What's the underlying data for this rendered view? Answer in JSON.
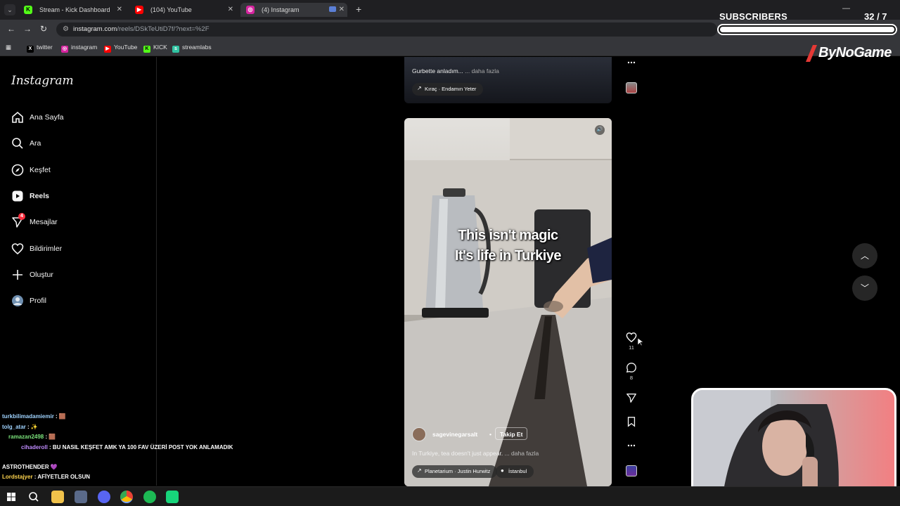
{
  "browser": {
    "tabs": [
      {
        "title": "Stream - Kick Dashboard",
        "favicon_color": "#53fc18",
        "favicon_glyph": "K"
      },
      {
        "title": "(104) YouTube",
        "favicon_color": "#ff0000",
        "favicon_glyph": "▶"
      },
      {
        "title": "(4) Instagram",
        "favicon_color": "#d6249f",
        "favicon_glyph": "◎"
      }
    ],
    "url_host": "instagram.com",
    "url_path": "/reels/DSkTeUtiD7f/?next=%2F",
    "bookmarks": [
      {
        "label": "twitter",
        "color": "#000000",
        "glyph": "X"
      },
      {
        "label": "instagram",
        "color": "#d6249f",
        "glyph": "◎"
      },
      {
        "label": "YouTube",
        "color": "#ff0000",
        "glyph": "▶"
      },
      {
        "label": "KICK",
        "color": "#53fc18",
        "glyph": "K"
      },
      {
        "label": "streamlabs",
        "color": "#31c3a2",
        "glyph": "s"
      }
    ]
  },
  "overlay": {
    "subs_label": "SUBSCRIBERS",
    "subs_count": "32 / 7",
    "subs_progress": 1.0,
    "brand": "ByNoGame"
  },
  "sidebar": {
    "logo": "Instagram",
    "items": [
      {
        "label": "Ana Sayfa",
        "icon": "home-icon",
        "bold": false
      },
      {
        "label": "Ara",
        "icon": "search-icon",
        "bold": false
      },
      {
        "label": "Keşfet",
        "icon": "explore-icon",
        "bold": false
      },
      {
        "label": "Reels",
        "icon": "reels-icon",
        "bold": true
      },
      {
        "label": "Mesajlar",
        "icon": "messages-icon",
        "bold": false,
        "badge": "4"
      },
      {
        "label": "Bildirimler",
        "icon": "heart-icon",
        "bold": false
      },
      {
        "label": "Oluştur",
        "icon": "create-icon",
        "bold": false
      },
      {
        "label": "Profil",
        "icon": "avatar",
        "bold": false
      }
    ]
  },
  "reel_prev": {
    "caption": "Gurbette anladım...",
    "more": "... daha fazla",
    "music": "Kıraç · Endamın Yeter"
  },
  "reel": {
    "overlay_line1": "This isn't magic",
    "overlay_line2": "It's life in Turkiye",
    "username": "sagevinegarsalt",
    "separator": "•",
    "follow": "Takip Et",
    "caption": "In Turkiye, tea doesn't just appear.",
    "more": "... daha fazla",
    "music": "Planetarium · Justin Hurwitz",
    "location": "İstanbul",
    "likes": "11",
    "comments": "8"
  },
  "chat": [
    {
      "user": "turkbilimadamiemir",
      "msg": "🟫"
    },
    {
      "user": "tolg_atar",
      "msg": "✨"
    },
    {
      "user": "ramazan2498",
      "msg": "🟫"
    },
    {
      "user": "cihaderoll",
      "msg": "BU NASIL KEŞFET AMK YA 100 FAV ÜZERİ POST YOK ANLAMADIK"
    },
    {
      "user": "ASTROTHENDER",
      "msg": "💜"
    },
    {
      "user": "Lordstajyer",
      "msg": "AFİYETLER OLSUN"
    }
  ],
  "colors": {
    "accent": "#0095f6",
    "badge": "#ff3040",
    "brand_red": "#e53935"
  }
}
